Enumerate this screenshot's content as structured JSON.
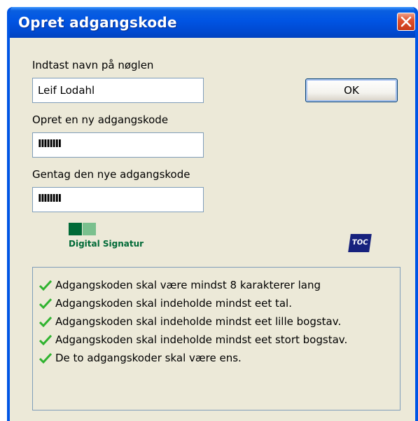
{
  "window": {
    "title": "Opret adgangskode"
  },
  "form": {
    "name_label": "Indtast navn på nøglen",
    "name_value": "Leif Lodahl",
    "new_password_label": "Opret en ny adgangskode",
    "new_password_value": "IIIIIIII",
    "repeat_password_label": "Gentag den nye adgangskode",
    "repeat_password_value": "IIIIIIII"
  },
  "buttons": {
    "ok_label": "OK"
  },
  "logos": {
    "digital_signatur": "Digital Signatur",
    "toc": "TOC"
  },
  "rules": [
    {
      "text": "Adgangskoden skal være mindst 8 karakterer lang",
      "satisfied": true
    },
    {
      "text": "Adgangskoden skal indeholde mindst eet tal.",
      "satisfied": true
    },
    {
      "text": "Adgangskoden skal indeholde mindst eet lille bogstav.",
      "satisfied": true
    },
    {
      "text": "Adgangskoden skal indeholde mindst eet stort bogstav.",
      "satisfied": true
    },
    {
      "text": "De to adgangskoder skal være ens.",
      "satisfied": true
    }
  ],
  "colors": {
    "titlebar": "#0054e3",
    "check": "#2fb32f",
    "close": "#e0512d",
    "ds_green": "#006a37",
    "toc_blue": "#16217d"
  }
}
